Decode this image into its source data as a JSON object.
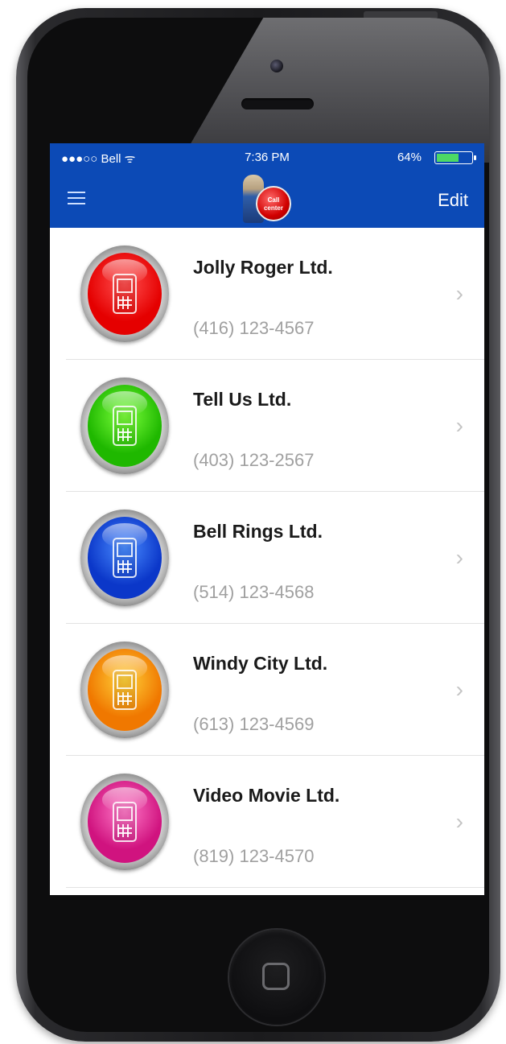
{
  "status_bar": {
    "carrier": "●●●○○ Bell ᯤ",
    "time": "7:36 PM",
    "battery_percent": "64%",
    "battery_level": 0.64
  },
  "nav": {
    "menu_icon": "hamburger-menu-icon",
    "logo_text": "Call center",
    "edit_label": "Edit"
  },
  "contacts": [
    {
      "name": "Jolly Roger Ltd.",
      "phone": "(416) 123-4567",
      "color": "#e50000",
      "highlight": "#ff5050"
    },
    {
      "name": "Tell Us Ltd.",
      "phone": "(403) 123-2567",
      "color": "#1fb800",
      "highlight": "#7dff3c"
    },
    {
      "name": "Bell Rings Ltd.",
      "phone": "(514) 123-4568",
      "color": "#0b37c9",
      "highlight": "#4a8cff"
    },
    {
      "name": "Windy City Ltd.",
      "phone": "(613) 123-4569",
      "color": "#f07800",
      "highlight": "#ffd23a"
    },
    {
      "name": "Video Movie Ltd.",
      "phone": "(819) 123-4570",
      "color": "#d0137f",
      "highlight": "#ff7ac8"
    }
  ],
  "icons": {
    "row_icon": "mobile-phone-icon",
    "disclosure": "chevron-right-icon",
    "chevron_glyph": "›"
  },
  "colors": {
    "header": "#0c4ab6",
    "separator": "#e2e2e2",
    "phone_text": "#a0a0a0"
  }
}
